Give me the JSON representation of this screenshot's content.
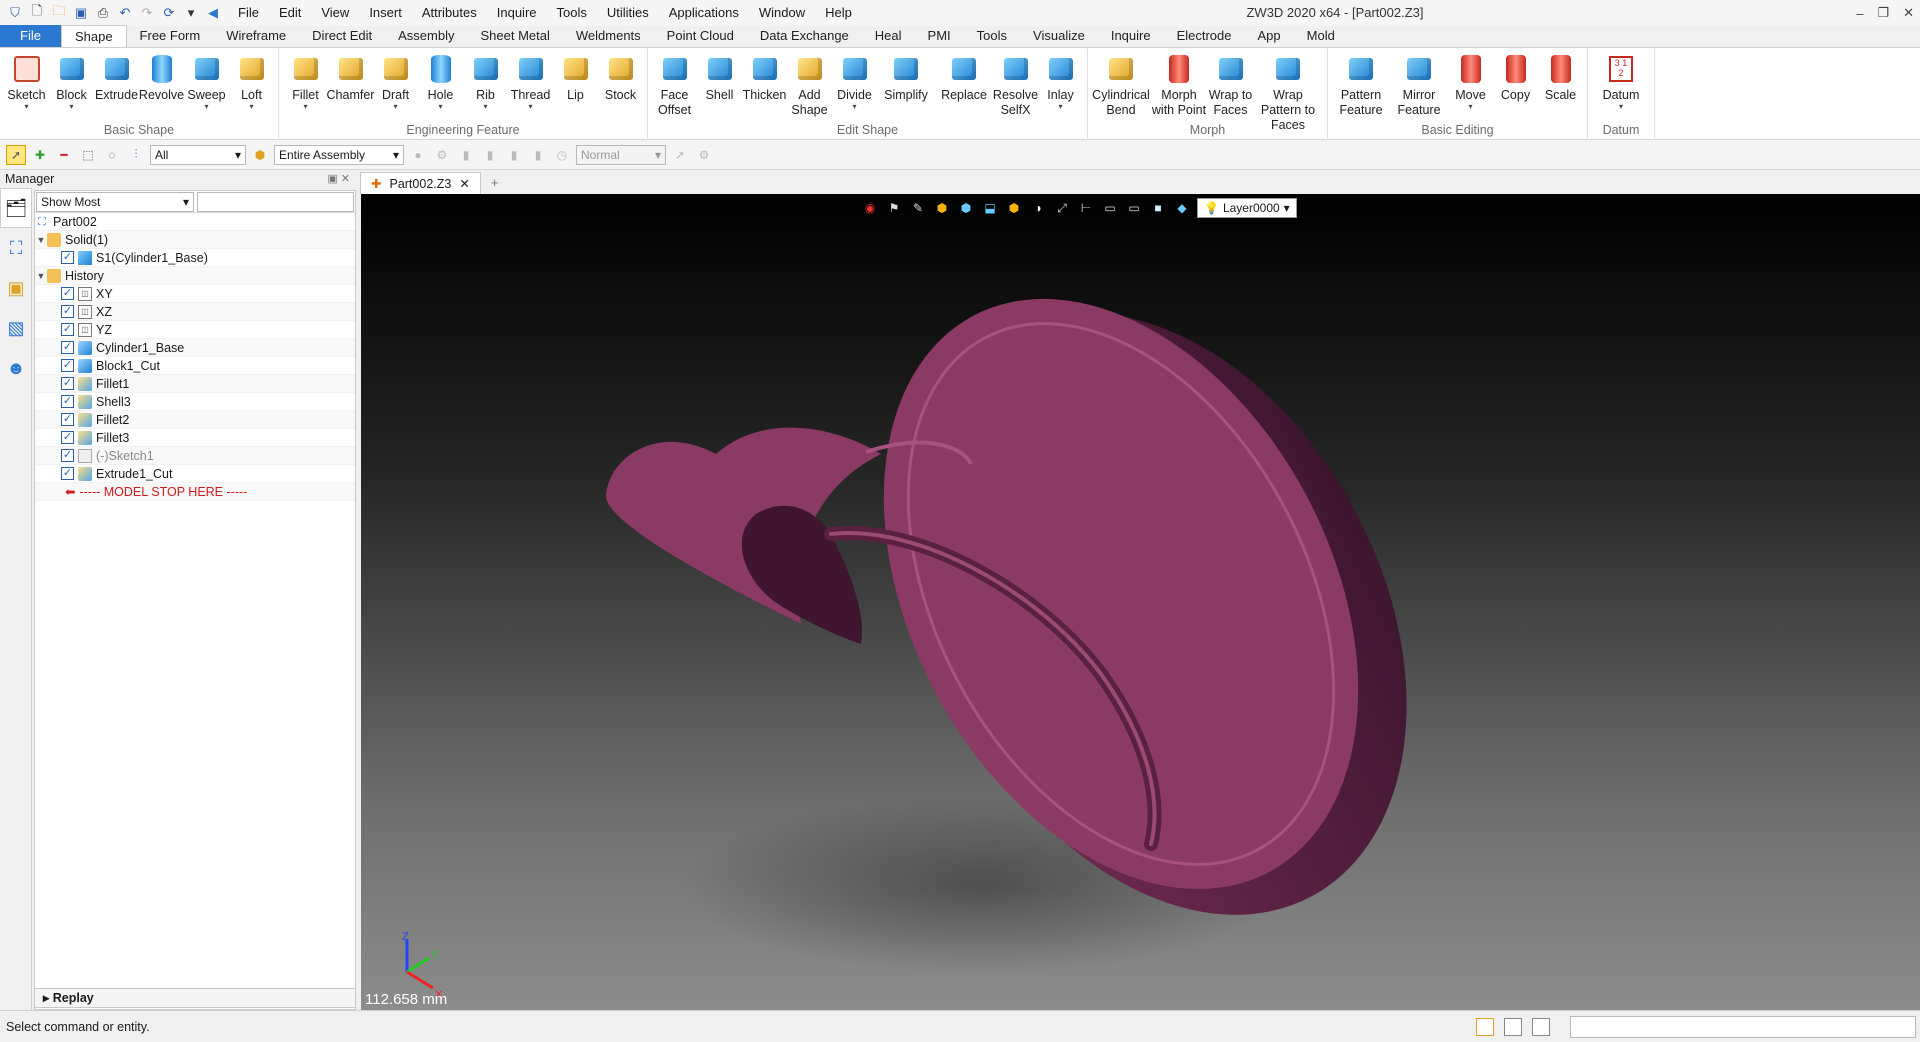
{
  "app": {
    "title": "ZW3D 2020 x64 - [Part002.Z3]"
  },
  "menu": [
    "File",
    "Edit",
    "View",
    "Insert",
    "Attributes",
    "Inquire",
    "Tools",
    "Utilities",
    "Applications",
    "Window",
    "Help"
  ],
  "ribbon_tabs": [
    "File",
    "Shape",
    "Free Form",
    "Wireframe",
    "Direct Edit",
    "Assembly",
    "Sheet Metal",
    "Weldments",
    "Point Cloud",
    "Data Exchange",
    "Heal",
    "PMI",
    "Tools",
    "Visualize",
    "Inquire",
    "Electrode",
    "App",
    "Mold"
  ],
  "ribbon": {
    "basic_shape": {
      "label": "Basic Shape",
      "items": [
        "Sketch",
        "Block",
        "Extrude",
        "Revolve",
        "Sweep",
        "Loft"
      ]
    },
    "engineering_feature": {
      "label": "Engineering Feature",
      "items": [
        "Fillet",
        "Chamfer",
        "Draft",
        "Hole",
        "Rib",
        "Thread",
        "Lip",
        "Stock"
      ]
    },
    "edit_shape": {
      "label": "Edit Shape",
      "items": [
        "Face Offset",
        "Shell",
        "Thicken",
        "Add Shape",
        "Divide",
        "Simplify",
        "Replace",
        "Resolve SelfX",
        "Inlay"
      ]
    },
    "morph": {
      "label": "Morph",
      "items": [
        "Cylindrical Bend",
        "Morph with Point",
        "Wrap to Faces",
        "Wrap Pattern to Faces"
      ]
    },
    "basic_editing": {
      "label": "Basic Editing",
      "items": [
        "Pattern Feature",
        "Mirror Feature",
        "Move",
        "Copy",
        "Scale"
      ]
    },
    "datum": {
      "label": "Datum",
      "items": [
        "Datum"
      ]
    }
  },
  "toolbar2": {
    "filter": "All",
    "scope": "Entire Assembly",
    "display": "Normal"
  },
  "manager": {
    "title": "Manager",
    "filter": "Show Most",
    "root": "Part002",
    "solid_folder": "Solid(1)",
    "solid_item": "S1(Cylinder1_Base)",
    "history_folder": "History",
    "history": [
      "XY",
      "XZ",
      "YZ",
      "Cylinder1_Base",
      "Block1_Cut",
      "Fillet1",
      "Shell3",
      "Fillet2",
      "Fillet3",
      "(-)Sketch1",
      "Extrude1_Cut"
    ],
    "stop_line": "----- MODEL STOP HERE -----",
    "replay": "Replay"
  },
  "doc_tab": "Part002.Z3",
  "viewport": {
    "layer": "Layer0000",
    "scale": "112.658 mm",
    "axis_labels": [
      "Z",
      "Y",
      "X"
    ],
    "part_color": "#8a3a64"
  },
  "status": "Select command or entity."
}
